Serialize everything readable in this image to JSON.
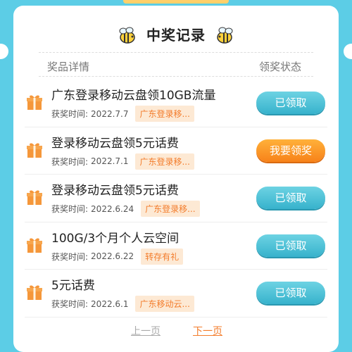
{
  "header": {
    "title": "中奖记录"
  },
  "columns": {
    "details": "奖品详情",
    "status": "领奖状态"
  },
  "records": [
    {
      "name": "广东登录移动云盘领10GB流量",
      "time_label": "获奖时间:",
      "date": "2022.7.7",
      "tag": "广东登录移...",
      "action": "已领取",
      "action_state": "claimed"
    },
    {
      "name": "登录移动云盘领5元话费",
      "time_label": "获奖时间:",
      "date": "2022.7.1",
      "tag": "广东登录移...",
      "action": "我要领奖",
      "action_state": "claim"
    },
    {
      "name": "登录移动云盘领5元话费",
      "time_label": "获奖时间:",
      "date": "2022.6.24",
      "tag": "广东登录移...",
      "action": "已领取",
      "action_state": "claimed"
    },
    {
      "name": "100G/3个月个人云空间",
      "time_label": "获奖时间:",
      "date": "2022.6.22",
      "tag": "转存有礼",
      "action": "已领取",
      "action_state": "claimed"
    },
    {
      "name": "5元话费",
      "time_label": "获奖时间:",
      "date": "2022.6.1",
      "tag": "广东移动云...",
      "action": "已领取",
      "action_state": "claimed"
    }
  ],
  "pager": {
    "prev": "上一页",
    "next": "下一页"
  },
  "colors": {
    "background": "#5ccde6",
    "claimed_button": "#37b2cc",
    "claim_button": "#f7821a",
    "tag_text": "#f37c2b"
  },
  "icons": {
    "title_decoration": "bee-icon",
    "record": "gift-icon"
  }
}
